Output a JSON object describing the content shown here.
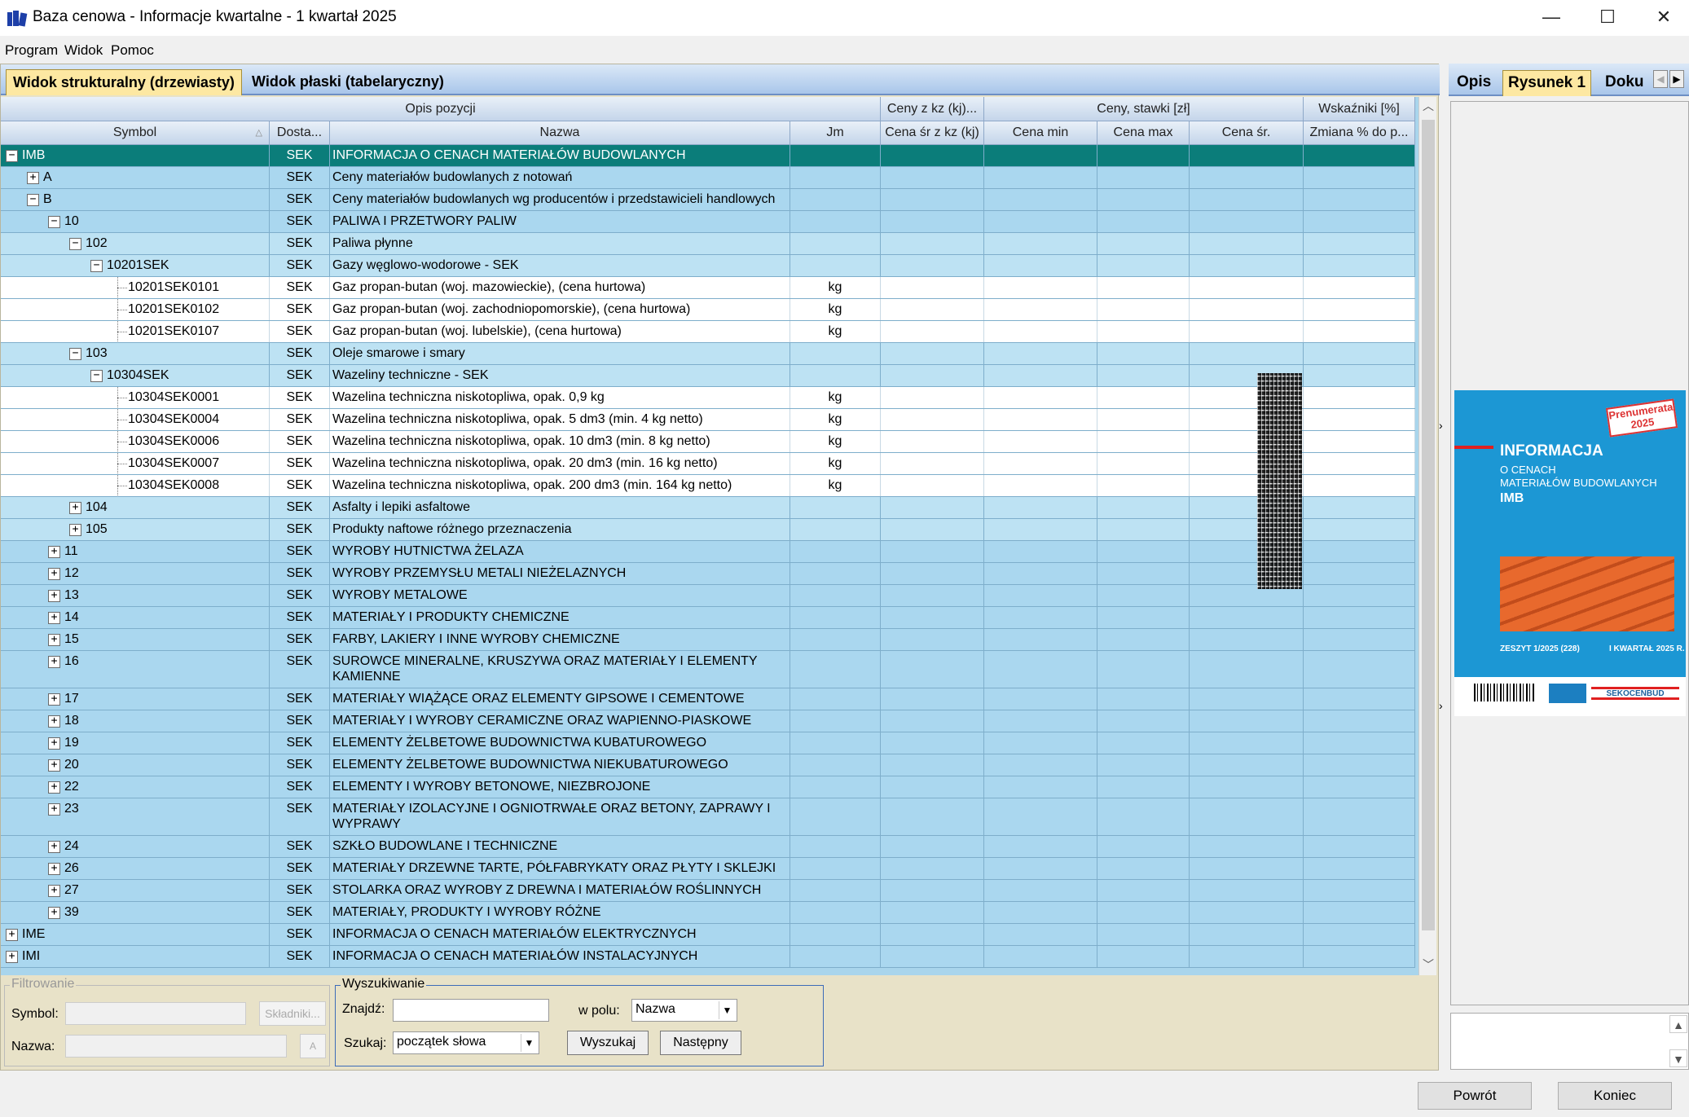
{
  "window": {
    "title": "Baza cenowa - Informacje kwartalne - 1 kwartał 2025",
    "min": "—",
    "max": "☐",
    "close": "✕"
  },
  "menu": [
    "Program",
    "Widok",
    "Pomoc"
  ],
  "tabs": [
    "Widok strukturalny (drzewiasty)",
    "Widok płaski (tabelaryczny)"
  ],
  "grid": {
    "groups": [
      "Opis pozycji",
      "Ceny z kz (kj)...",
      "Ceny, stawki [zł]",
      "Wskaźniki [%]"
    ],
    "columns": [
      "Symbol",
      "Dosta...",
      "Nazwa",
      "Jm",
      "Cena śr z kz (kj)",
      "Cena min",
      "Cena max",
      "Cena śr.",
      "Zmiana % do p..."
    ],
    "rows": [
      {
        "symbol": "IMB",
        "dost": "SEK",
        "name": "INFORMACJA O CENACH MATERIAŁÓW BUDOWLANYCH",
        "jm": ""
      },
      {
        "symbol": "A",
        "dost": "SEK",
        "name": "Ceny materiałów budowlanych z notowań",
        "jm": ""
      },
      {
        "symbol": "B",
        "dost": "SEK",
        "name": "Ceny materiałów budowlanych wg producentów i przedstawicieli handlowych",
        "jm": ""
      },
      {
        "symbol": "10",
        "dost": "SEK",
        "name": "PALIWA I PRZETWORY PALIW",
        "jm": ""
      },
      {
        "symbol": "102",
        "dost": "SEK",
        "name": "Paliwa płynne",
        "jm": ""
      },
      {
        "symbol": "10201SEK",
        "dost": "SEK",
        "name": "Gazy węglowo-wodorowe - SEK",
        "jm": ""
      },
      {
        "symbol": "10201SEK0101",
        "dost": "SEK",
        "name": "Gaz propan-butan (woj. mazowieckie), (cena hurtowa)",
        "jm": "kg"
      },
      {
        "symbol": "10201SEK0102",
        "dost": "SEK",
        "name": "Gaz propan-butan (woj. zachodniopomorskie), (cena hurtowa)",
        "jm": "kg"
      },
      {
        "symbol": "10201SEK0107",
        "dost": "SEK",
        "name": "Gaz propan-butan (woj. lubelskie), (cena hurtowa)",
        "jm": "kg"
      },
      {
        "symbol": "103",
        "dost": "SEK",
        "name": "Oleje smarowe i smary",
        "jm": ""
      },
      {
        "symbol": "10304SEK",
        "dost": "SEK",
        "name": "Wazeliny techniczne - SEK",
        "jm": ""
      },
      {
        "symbol": "10304SEK0001",
        "dost": "SEK",
        "name": "Wazelina techniczna niskotopliwa, opak. 0,9 kg",
        "jm": "kg"
      },
      {
        "symbol": "10304SEK0004",
        "dost": "SEK",
        "name": "Wazelina techniczna niskotopliwa, opak. 5 dm3 (min. 4 kg netto)",
        "jm": "kg"
      },
      {
        "symbol": "10304SEK0006",
        "dost": "SEK",
        "name": "Wazelina techniczna niskotopliwa, opak. 10 dm3 (min. 8 kg netto)",
        "jm": "kg"
      },
      {
        "symbol": "10304SEK0007",
        "dost": "SEK",
        "name": "Wazelina techniczna niskotopliwa, opak. 20 dm3 (min. 16 kg netto)",
        "jm": "kg"
      },
      {
        "symbol": "10304SEK0008",
        "dost": "SEK",
        "name": "Wazelina techniczna niskotopliwa, opak. 200 dm3 (min. 164 kg netto)",
        "jm": "kg"
      },
      {
        "symbol": "104",
        "dost": "SEK",
        "name": "Asfalty i lepiki asfaltowe",
        "jm": ""
      },
      {
        "symbol": "105",
        "dost": "SEK",
        "name": "Produkty naftowe różnego przeznaczenia",
        "jm": ""
      },
      {
        "symbol": "11",
        "dost": "SEK",
        "name": "WYROBY HUTNICTWA ŻELAZA",
        "jm": ""
      },
      {
        "symbol": "12",
        "dost": "SEK",
        "name": "WYROBY PRZEMYSŁU METALI NIEŻELAZNYCH",
        "jm": ""
      },
      {
        "symbol": "13",
        "dost": "SEK",
        "name": "WYROBY METALOWE",
        "jm": ""
      },
      {
        "symbol": "14",
        "dost": "SEK",
        "name": "MATERIAŁY I PRODUKTY CHEMICZNE",
        "jm": ""
      },
      {
        "symbol": "15",
        "dost": "SEK",
        "name": "FARBY, LAKIERY I INNE WYROBY CHEMICZNE",
        "jm": ""
      },
      {
        "symbol": "16",
        "dost": "SEK",
        "name": "SUROWCE MINERALNE, KRUSZYWA ORAZ MATERIAŁY I ELEMENTY KAMIENNE",
        "jm": ""
      },
      {
        "symbol": "17",
        "dost": "SEK",
        "name": "MATERIAŁY WIĄŻĄCE ORAZ ELEMENTY GIPSOWE I CEMENTOWE",
        "jm": ""
      },
      {
        "symbol": "18",
        "dost": "SEK",
        "name": "MATERIAŁY I WYROBY CERAMICZNE ORAZ WAPIENNO-PIASKOWE",
        "jm": ""
      },
      {
        "symbol": "19",
        "dost": "SEK",
        "name": "ELEMENTY ŻELBETOWE BUDOWNICTWA KUBATUROWEGO",
        "jm": ""
      },
      {
        "symbol": "20",
        "dost": "SEK",
        "name": "ELEMENTY ŻELBETOWE BUDOWNICTWA NIEKUBATUROWEGO",
        "jm": ""
      },
      {
        "symbol": "22",
        "dost": "SEK",
        "name": "ELEMENTY I WYROBY BETONOWE, NIEZBROJONE",
        "jm": ""
      },
      {
        "symbol": "23",
        "dost": "SEK",
        "name": "MATERIAŁY IZOLACYJNE I OGNIOTRWAŁE ORAZ BETONY, ZAPRAWY I WYPRAWY",
        "jm": ""
      },
      {
        "symbol": "24",
        "dost": "SEK",
        "name": "SZKŁO BUDOWLANE I TECHNICZNE",
        "jm": ""
      },
      {
        "symbol": "26",
        "dost": "SEK",
        "name": "MATERIAŁY DRZEWNE TARTE, PÓŁFABRYKATY ORAZ PŁYTY I SKLEJKI",
        "jm": ""
      },
      {
        "symbol": "27",
        "dost": "SEK",
        "name": "STOLARKA ORAZ WYROBY Z DREWNA I MATERIAŁÓW ROŚLINNYCH",
        "jm": ""
      },
      {
        "symbol": "39",
        "dost": "SEK",
        "name": "MATERIAŁY, PRODUKTY I WYROBY RÓŻNE",
        "jm": ""
      },
      {
        "symbol": "IME",
        "dost": "SEK",
        "name": "INFORMACJA O CENACH MATERIAŁÓW ELEKTRYCZNYCH",
        "jm": ""
      },
      {
        "symbol": "IMI",
        "dost": "SEK",
        "name": "INFORMACJA O CENACH MATERIAŁÓW INSTALACYJNYCH",
        "jm": ""
      }
    ]
  },
  "filter": {
    "legend": "Filtrowanie",
    "symbol_label": "Symbol:",
    "name_label": "Nazwa:",
    "components_btn": "Składniki...",
    "clear_btn": "A"
  },
  "search": {
    "legend": "Wyszukiwanie",
    "find_label": "Znajdź:",
    "field_label": "w polu:",
    "field_value": "Nazwa",
    "mode_label": "Szukaj:",
    "mode_value": "początek słowa",
    "search_btn": "Wyszukaj",
    "next_btn": "Następny"
  },
  "right_panel": {
    "tabs": [
      "Opis",
      "Rysunek 1",
      "Doku"
    ],
    "cover": {
      "stamp": "Prenumerata 2025",
      "title": "INFORMACJA",
      "sub1": "O CENACH",
      "sub2": "MATERIAŁÓW BUDOWLANYCH",
      "code": "IMB",
      "issue": "ZESZYT 1/2025 (228)",
      "quarter": "I KWARTAŁ 2025 R.",
      "brand": "SEKOCENBUD"
    }
  },
  "buttons": {
    "back": "Powrót",
    "end": "Koniec"
  },
  "colors": {
    "selected_row": "#0b7d7a",
    "grid_bg": "#a9d5ec",
    "active_tab": "#fde8a2"
  }
}
